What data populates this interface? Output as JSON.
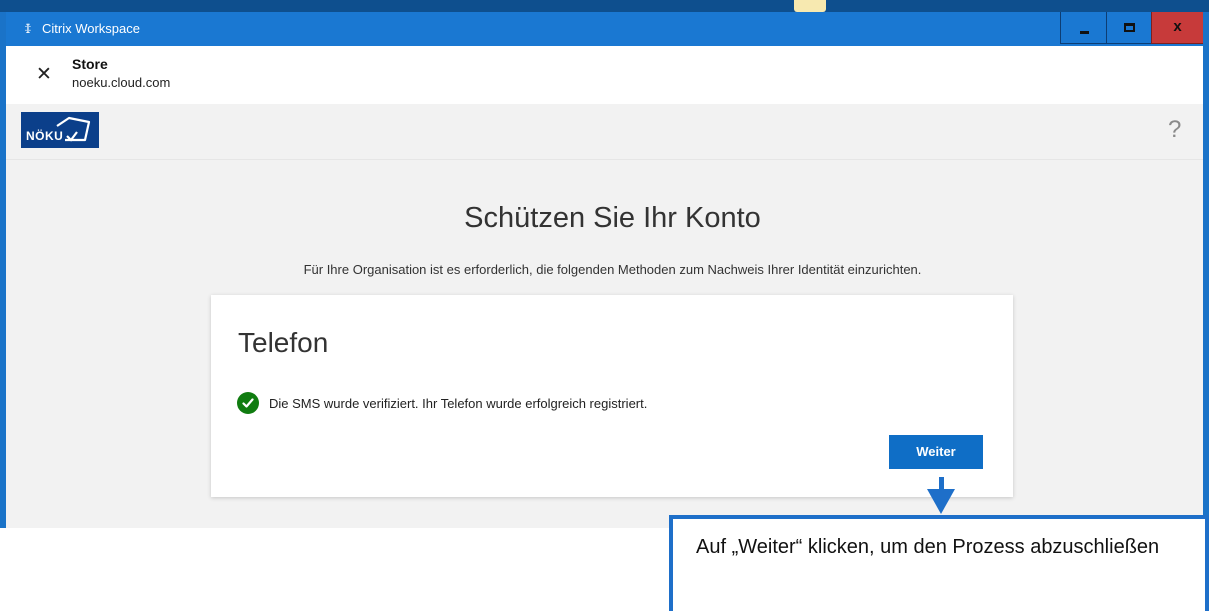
{
  "window": {
    "title": "Citrix Workspace",
    "close_glyph": "x"
  },
  "store": {
    "title": "Store",
    "url": "noeku.cloud.com"
  },
  "brand": {
    "logo_text": "NÖKU",
    "help_glyph": "?"
  },
  "page": {
    "heading": "Schützen Sie Ihr Konto",
    "subtext": "Für Ihre Organisation ist es erforderlich, die folgenden Methoden zum Nachweis Ihrer Identität einzurichten."
  },
  "card": {
    "title": "Telefon",
    "success_text": "Die SMS wurde verifiziert. Ihr Telefon wurde erfolgreich registriert.",
    "button_label": "Weiter"
  },
  "annotation": {
    "text": "Auf „Weiter“ klicken, um den Prozess abzuschließen"
  },
  "colors": {
    "window_chrome": "#1a78d2",
    "primary_button": "#0f6ec6",
    "success": "#107c10",
    "close_button": "#c73a3a",
    "logo_bg": "#0b3f8a"
  }
}
